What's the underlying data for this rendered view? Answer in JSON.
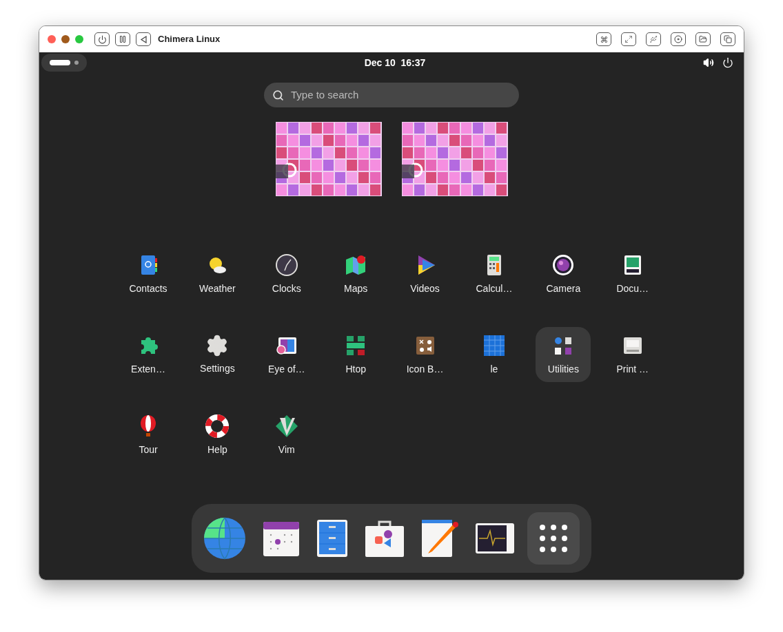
{
  "window": {
    "title": "Chimera Linux"
  },
  "top_bar": {
    "clock": "Dec 10  16:37"
  },
  "search": {
    "placeholder": "Type to search"
  },
  "app_grid": [
    {
      "label": "Contacts",
      "selected": false
    },
    {
      "label": "Weather",
      "selected": false
    },
    {
      "label": "Clocks",
      "selected": false
    },
    {
      "label": "Maps",
      "selected": false
    },
    {
      "label": "Videos",
      "selected": false
    },
    {
      "label": "Calcul…",
      "selected": false
    },
    {
      "label": "Camera",
      "selected": false
    },
    {
      "label": "Docu…",
      "selected": false
    },
    {
      "label": "Exten…",
      "selected": false
    },
    {
      "label": "Settings",
      "selected": false
    },
    {
      "label": "Eye of…",
      "selected": false
    },
    {
      "label": "Htop",
      "selected": false
    },
    {
      "label": "Icon B…",
      "selected": false
    },
    {
      "label": "le",
      "selected": false
    },
    {
      "label": "Utilities",
      "selected": true
    },
    {
      "label": "Print …",
      "selected": false
    },
    {
      "label": "Tour",
      "selected": false
    },
    {
      "label": "Help",
      "selected": false
    },
    {
      "label": "Vim",
      "selected": false
    }
  ]
}
